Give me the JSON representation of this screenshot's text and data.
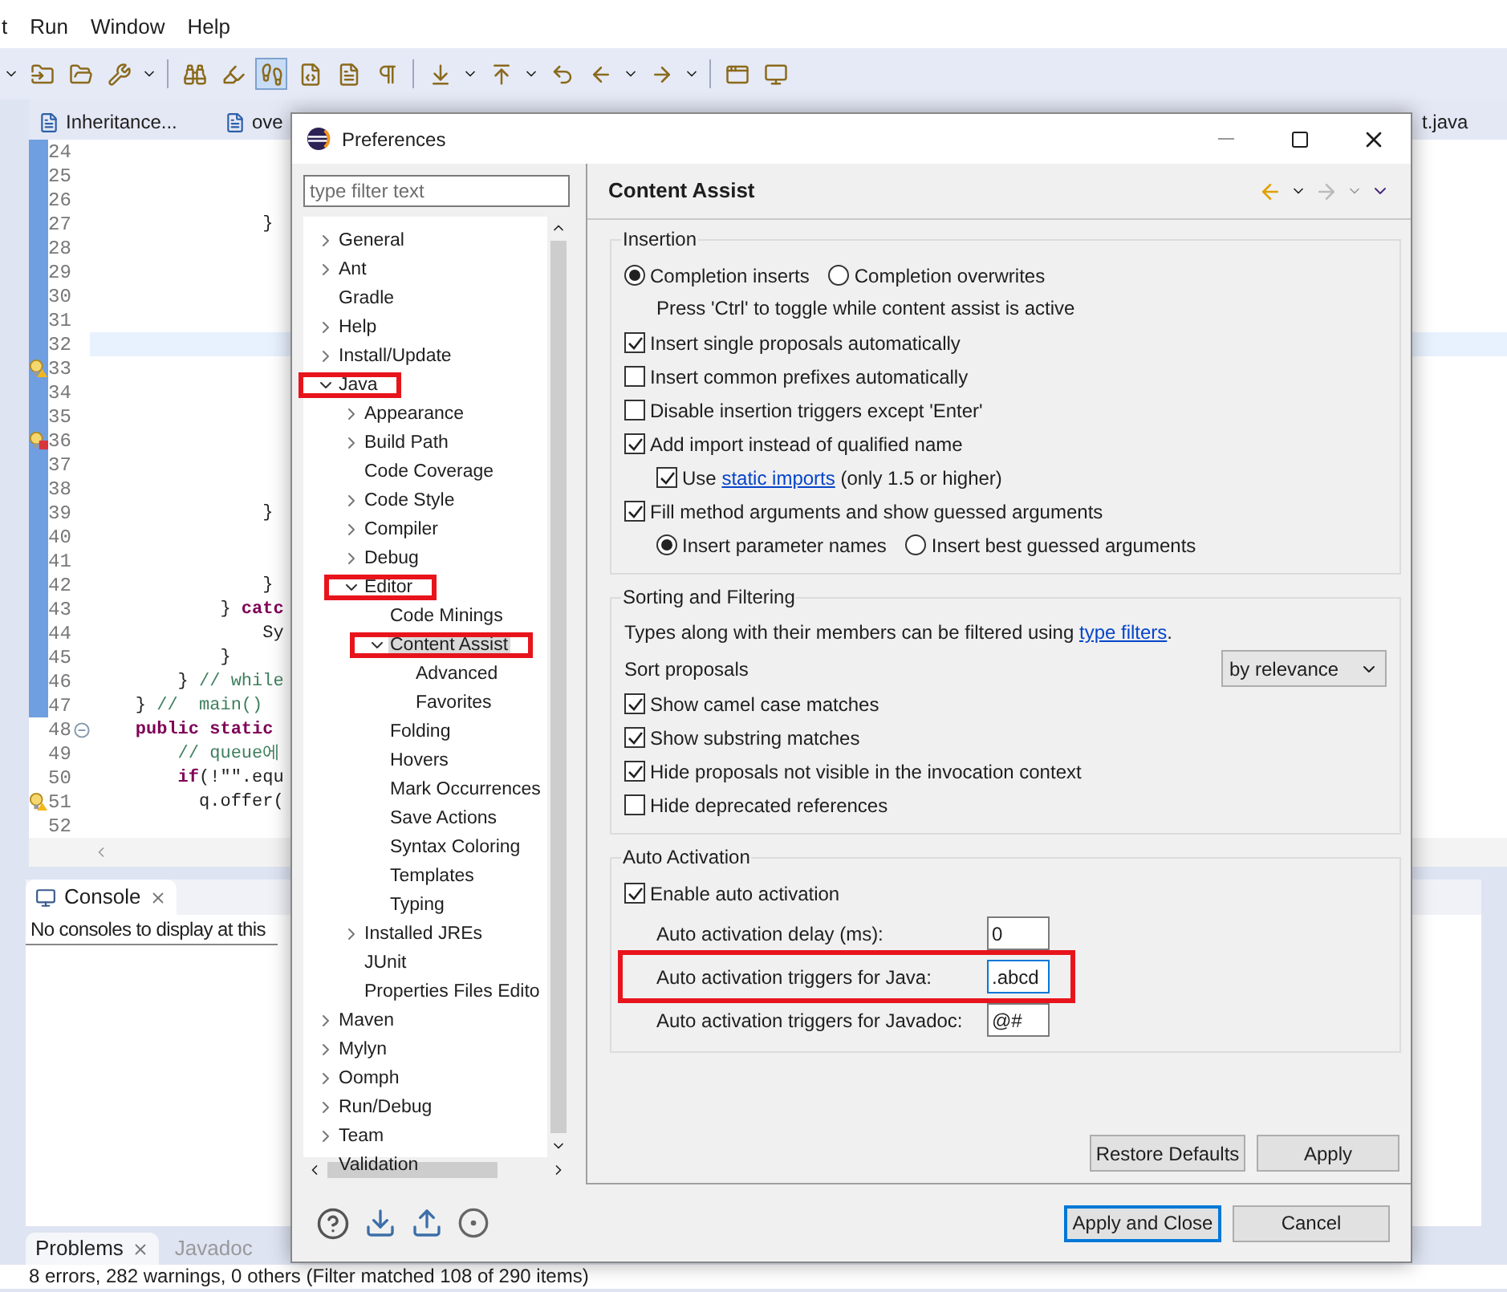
{
  "menu_bar": [
    {
      "label": "t"
    },
    {
      "label": "Run"
    },
    {
      "label": "Window"
    },
    {
      "label": "Help"
    }
  ],
  "toolbar": [
    {
      "pressed": false
    },
    {
      "pressed": false
    },
    {
      "pressed": false
    },
    {
      "pressed": false
    },
    {
      "pressed": false
    },
    {
      "pressed": true
    },
    {
      "pressed": false
    },
    {
      "pressed": false
    },
    {
      "pressed": false
    },
    {
      "pressed": false
    },
    {
      "pressed": false
    },
    {
      "pressed": false
    },
    {
      "pressed": false
    },
    {
      "pressed": false
    },
    {
      "pressed": false
    },
    {
      "pressed": false
    }
  ],
  "editor_tabs": [
    {
      "label": "Inheritance...",
      "kind": "java"
    },
    {
      "label": "ove",
      "kind": "java"
    },
    {
      "label": "t.java",
      "kind": "plain"
    }
  ],
  "editor_lines": [
    {
      "number": "24",
      "current": false,
      "range": true,
      "kind": "plain"
    },
    {
      "number": "25",
      "current": false,
      "range": true,
      "kind": "plain"
    },
    {
      "number": "26",
      "current": false,
      "range": true,
      "kind": "plain"
    },
    {
      "number": "27",
      "current": false,
      "range": true,
      "kind": "plain",
      "segments": [
        {
          "t": "                }",
          "kind": "plain"
        }
      ]
    },
    {
      "number": "28",
      "current": false,
      "range": true,
      "kind": "plain"
    },
    {
      "number": "29",
      "current": false,
      "range": true,
      "kind": "plain"
    },
    {
      "number": "30",
      "current": false,
      "range": true,
      "kind": "plain"
    },
    {
      "number": "31",
      "current": false,
      "range": true,
      "kind": "plain"
    },
    {
      "number": "32",
      "current": true,
      "range": true,
      "kind": "plain"
    },
    {
      "number": "33",
      "current": false,
      "range": true,
      "kind": "warning"
    },
    {
      "number": "34",
      "current": false,
      "range": true,
      "kind": "plain"
    },
    {
      "number": "35",
      "current": false,
      "range": true,
      "kind": "plain"
    },
    {
      "number": "36",
      "current": false,
      "range": true,
      "kind": "error"
    },
    {
      "number": "37",
      "current": false,
      "range": true,
      "kind": "plain"
    },
    {
      "number": "38",
      "current": false,
      "range": true,
      "kind": "plain"
    },
    {
      "number": "39",
      "current": false,
      "range": true,
      "kind": "plain",
      "segments": [
        {
          "t": "                }",
          "kind": "plain"
        }
      ]
    },
    {
      "number": "40",
      "current": false,
      "range": true,
      "kind": "plain"
    },
    {
      "number": "41",
      "current": false,
      "range": true,
      "kind": "plain"
    },
    {
      "number": "42",
      "current": false,
      "range": true,
      "kind": "plain",
      "segments": [
        {
          "t": "                }",
          "kind": "plain"
        }
      ]
    },
    {
      "number": "43",
      "current": false,
      "range": true,
      "kind": "plain",
      "segments": [
        {
          "t": "            } ",
          "kind": "plain"
        },
        {
          "t": "catc",
          "kind": "keyword"
        }
      ]
    },
    {
      "number": "44",
      "current": false,
      "range": true,
      "kind": "plain",
      "segments": [
        {
          "t": "                Sy",
          "kind": "plain"
        }
      ]
    },
    {
      "number": "45",
      "current": false,
      "range": true,
      "kind": "plain",
      "segments": [
        {
          "t": "            }",
          "kind": "plain"
        }
      ]
    },
    {
      "number": "46",
      "current": false,
      "range": true,
      "kind": "plain",
      "segments": [
        {
          "t": "        } ",
          "kind": "plain"
        },
        {
          "t": "// while",
          "kind": "comment"
        }
      ]
    },
    {
      "number": "47",
      "current": false,
      "range": true,
      "kind": "plain",
      "segments": [
        {
          "t": "    } ",
          "kind": "plain"
        },
        {
          "t": "//  main()",
          "kind": "comment"
        }
      ]
    },
    {
      "number": "48",
      "current": false,
      "range": false,
      "kind": "fold",
      "segments": [
        {
          "t": "    public static",
          "kind": "keyword"
        }
      ]
    },
    {
      "number": "49",
      "current": false,
      "range": false,
      "kind": "plain",
      "segments": [
        {
          "t": "        // queue에",
          "kind": "comment"
        }
      ]
    },
    {
      "number": "50",
      "current": false,
      "range": false,
      "kind": "plain",
      "segments": [
        {
          "t": "        if",
          "kind": "keyword"
        },
        {
          "t": "(!\"\".equ",
          "kind": "plain"
        }
      ]
    },
    {
      "number": "51",
      "current": false,
      "range": false,
      "kind": "warning",
      "segments": [
        {
          "t": "          q.offer(",
          "kind": "plain"
        }
      ]
    },
    {
      "number": "52",
      "current": false,
      "range": false,
      "kind": "plain"
    }
  ],
  "console": {
    "tab": "Console",
    "message": "No consoles to display at this"
  },
  "bottom_tabs": [
    {
      "label": "Problems",
      "selected": true
    },
    {
      "label": "Javadoc",
      "selected": false
    }
  ],
  "status": "8 errors, 282 warnings, 0 others (Filter matched 108 of 290 items)",
  "dialog": {
    "title": "Preferences",
    "filter": {
      "placeholder": "type filter text"
    },
    "tree": [
      {
        "label": "General",
        "kind": "collapsed",
        "selected": false,
        "highlighted": false
      },
      {
        "label": "Ant",
        "kind": "collapsed",
        "selected": false,
        "highlighted": false
      },
      {
        "label": "Gradle",
        "kind": "leaf",
        "selected": false,
        "highlighted": false
      },
      {
        "label": "Help",
        "kind": "collapsed",
        "selected": false,
        "highlighted": false
      },
      {
        "label": "Install/Update",
        "kind": "collapsed",
        "selected": false,
        "highlighted": false
      },
      {
        "label": "Java",
        "kind": "expanded",
        "selected": false,
        "highlighted": true,
        "children": [
          {
            "label": "Appearance",
            "kind": "collapsed",
            "selected": false,
            "highlighted": false
          },
          {
            "label": "Build Path",
            "kind": "collapsed",
            "selected": false,
            "highlighted": false
          },
          {
            "label": "Code Coverage",
            "kind": "leaf",
            "selected": false,
            "highlighted": false
          },
          {
            "label": "Code Style",
            "kind": "collapsed",
            "selected": false,
            "highlighted": false
          },
          {
            "label": "Compiler",
            "kind": "collapsed",
            "selected": false,
            "highlighted": false
          },
          {
            "label": "Debug",
            "kind": "collapsed",
            "selected": false,
            "highlighted": false
          },
          {
            "label": "Editor",
            "kind": "expanded",
            "selected": false,
            "highlighted": true,
            "children": [
              {
                "label": "Code Minings",
                "kind": "leaf",
                "selected": false,
                "highlighted": false
              },
              {
                "label": "Content Assist",
                "kind": "expanded",
                "selected": true,
                "highlighted": true,
                "children": [
                  {
                    "label": "Advanced",
                    "kind": "leaf",
                    "selected": false,
                    "highlighted": false
                  },
                  {
                    "label": "Favorites",
                    "kind": "leaf",
                    "selected": false,
                    "highlighted": false
                  }
                ]
              },
              {
                "label": "Folding",
                "kind": "leaf",
                "selected": false,
                "highlighted": false
              },
              {
                "label": "Hovers",
                "kind": "leaf",
                "selected": false,
                "highlighted": false
              },
              {
                "label": "Mark Occurrences",
                "kind": "leaf",
                "selected": false,
                "highlighted": false
              },
              {
                "label": "Save Actions",
                "kind": "leaf",
                "selected": false,
                "highlighted": false
              },
              {
                "label": "Syntax Coloring",
                "kind": "leaf",
                "selected": false,
                "highlighted": false
              },
              {
                "label": "Templates",
                "kind": "leaf",
                "selected": false,
                "highlighted": false
              },
              {
                "label": "Typing",
                "kind": "leaf",
                "selected": false,
                "highlighted": false
              }
            ]
          },
          {
            "label": "Installed JREs",
            "kind": "collapsed",
            "selected": false,
            "highlighted": false
          },
          {
            "label": "JUnit",
            "kind": "leaf",
            "selected": false,
            "highlighted": false
          },
          {
            "label": "Properties Files Edito",
            "kind": "leaf",
            "selected": false,
            "highlighted": false
          }
        ]
      },
      {
        "label": "Maven",
        "kind": "collapsed",
        "selected": false,
        "highlighted": false
      },
      {
        "label": "Mylyn",
        "kind": "collapsed",
        "selected": false,
        "highlighted": false
      },
      {
        "label": "Oomph",
        "kind": "collapsed",
        "selected": false,
        "highlighted": false
      },
      {
        "label": "Run/Debug",
        "kind": "collapsed",
        "selected": false,
        "highlighted": false
      },
      {
        "label": "Team",
        "kind": "collapsed",
        "selected": false,
        "highlighted": false
      },
      {
        "label": "Validation",
        "kind": "leaf",
        "selected": false,
        "highlighted": false
      }
    ],
    "page": {
      "title": "Content Assist",
      "groups": [
        {
          "title": "Insertion",
          "items": [
            {
              "kind": "radio_group",
              "options": [
                {
                  "label": "Completion inserts",
                  "selected": true
                },
                {
                  "label": "Completion overwrites",
                  "selected": false
                }
              ]
            },
            {
              "kind": "note",
              "text": "Press 'Ctrl' to toggle while content assist is active"
            },
            {
              "kind": "checkbox",
              "label": "Insert single proposals automatically",
              "checked": true
            },
            {
              "kind": "checkbox",
              "label": "Insert common prefixes automatically",
              "checked": false
            },
            {
              "kind": "checkbox",
              "label": "Disable insertion triggers except 'Enter'",
              "checked": false
            },
            {
              "kind": "checkbox",
              "label": "Add import instead of qualified name",
              "checked": true,
              "children": [
                {
                  "kind": "checkbox",
                  "label": "Use ",
                  "link": "static imports",
                  "suffix": " (only 1.5 or higher)",
                  "checked": true
                }
              ]
            },
            {
              "kind": "checkbox",
              "label": "Fill method arguments and show guessed arguments",
              "checked": true,
              "children": [
                {
                  "kind": "radio_group",
                  "options": [
                    {
                      "label": "Insert parameter names",
                      "selected": true
                    },
                    {
                      "label": "Insert best guessed arguments",
                      "selected": false
                    }
                  ]
                }
              ]
            }
          ]
        },
        {
          "title": "Sorting and Filtering",
          "items": [
            {
              "kind": "text",
              "text": "Types along with their members can be filtered using ",
              "link": "type filters",
              "suffix": "."
            },
            {
              "kind": "select",
              "label": "Sort proposals",
              "value": "by relevance"
            },
            {
              "kind": "checkbox",
              "label": "Show camel case matches",
              "checked": true
            },
            {
              "kind": "checkbox",
              "label": "Show substring matches",
              "checked": true
            },
            {
              "kind": "checkbox",
              "label": "Hide proposals not visible in the invocation context",
              "checked": true
            },
            {
              "kind": "checkbox",
              "label": "Hide deprecated references",
              "checked": false
            }
          ]
        },
        {
          "title": "Auto Activation",
          "items": [
            {
              "kind": "checkbox",
              "label": "Enable auto activation",
              "checked": true
            },
            {
              "kind": "field",
              "label": "Auto activation delay (ms):",
              "value": "0",
              "focused": false,
              "highlighted": false
            },
            {
              "kind": "field",
              "label": "Auto activation triggers for Java:",
              "value": ".abcd",
              "focused": true,
              "highlighted": true
            },
            {
              "kind": "field",
              "label": "Auto activation triggers for Javadoc:",
              "value": "@#",
              "focused": false,
              "highlighted": false
            }
          ]
        }
      ]
    },
    "page_buttons": [
      {
        "label": "Restore Defaults",
        "default": false
      },
      {
        "label": "Apply",
        "default": false
      }
    ],
    "footer_buttons": [
      {
        "label": "Apply and Close",
        "default": true
      },
      {
        "label": "Cancel",
        "default": false
      }
    ]
  }
}
